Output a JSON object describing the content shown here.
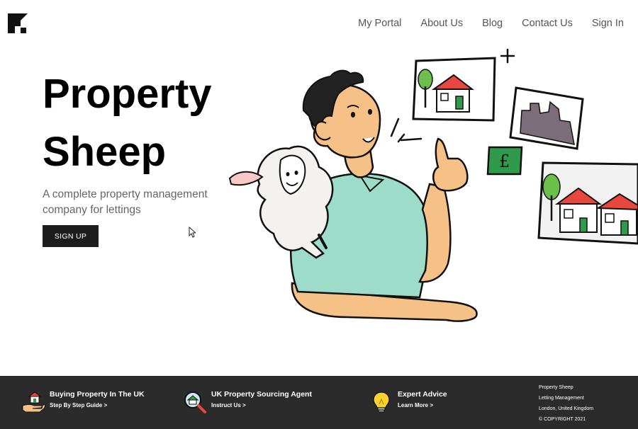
{
  "header": {
    "logo_icon": "brand-logo-icon",
    "nav": [
      {
        "label": "My Portal"
      },
      {
        "label": "About Us"
      },
      {
        "label": "Blog"
      },
      {
        "label": "Contact Us"
      },
      {
        "label": "Sign In"
      }
    ]
  },
  "hero": {
    "title_line1": "Property",
    "title_line2": "Sheep",
    "subtitle": "A complete property management company for lettings",
    "cta_label": "SIGN UP",
    "illustration": "man-with-sheep-thumbs-up-illustration"
  },
  "footer": {
    "items": [
      {
        "title": "Buying Property In The UK",
        "link": "Step By Step Guide >",
        "icon": "hand-house-icon"
      },
      {
        "title": "UK Property Sourcing Agent",
        "link": "Instruct Us >",
        "icon": "magnifier-house-icon"
      },
      {
        "title": "Expert Advice",
        "link": "Learn More >",
        "icon": "lightbulb-icon"
      }
    ],
    "info": {
      "name": "Property Sheep",
      "tagline": "Letting Management",
      "location": "London, United Kingdom",
      "copyright": "© COPYRIGHT 2021"
    }
  },
  "colors": {
    "footer_bg": "#2b2b2b",
    "button_bg": "#1d1d1d",
    "shirt": "#9ddcc9",
    "skin": "#f6c187",
    "roof": "#e7473c",
    "money": "#2f9a4a"
  }
}
